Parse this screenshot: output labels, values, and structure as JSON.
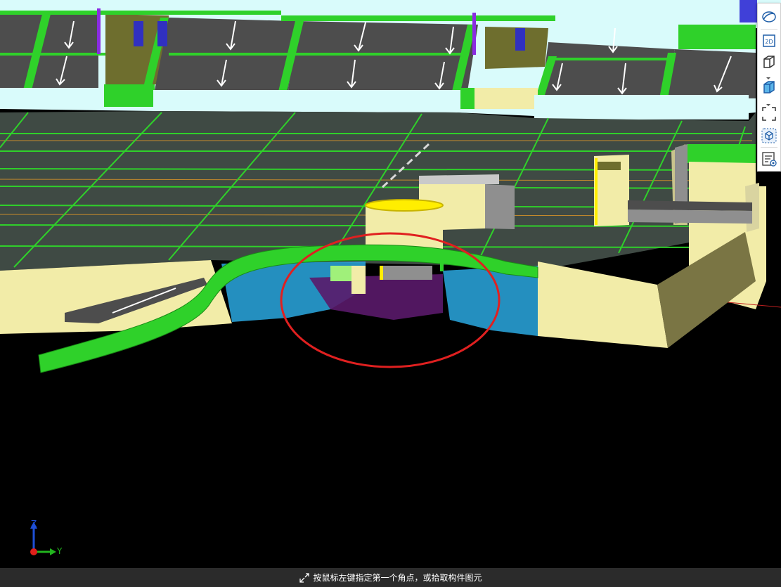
{
  "status_bar": {
    "prompt": "按鼠标左键指定第一个角点，或拾取构件图元",
    "icon": "select-corner-icon"
  },
  "axis_indicator": {
    "z_label": "Z",
    "y_label": "Y",
    "z_color": "#1e4fd6",
    "y_color": "#22b41e",
    "origin_color": "#e0201a"
  },
  "view_toolbar": {
    "buttons": [
      "perspective-orbit-icon",
      "2d-view-icon",
      "3d-box-view-icon",
      "3d-shaded-box-icon",
      "fit-view-icon",
      "isolate-element-icon",
      "display-settings-icon"
    ],
    "button_2d_text": "2D"
  },
  "scene": {
    "background": "#000000",
    "slab_color": "#3f4a44",
    "beam_color": "#2fd12a",
    "wall_color": "#f2eca8",
    "ceiling_color": "#d9fbfb",
    "water_color": "#2aa8e0",
    "highlight_circle_color": "#e02020"
  }
}
